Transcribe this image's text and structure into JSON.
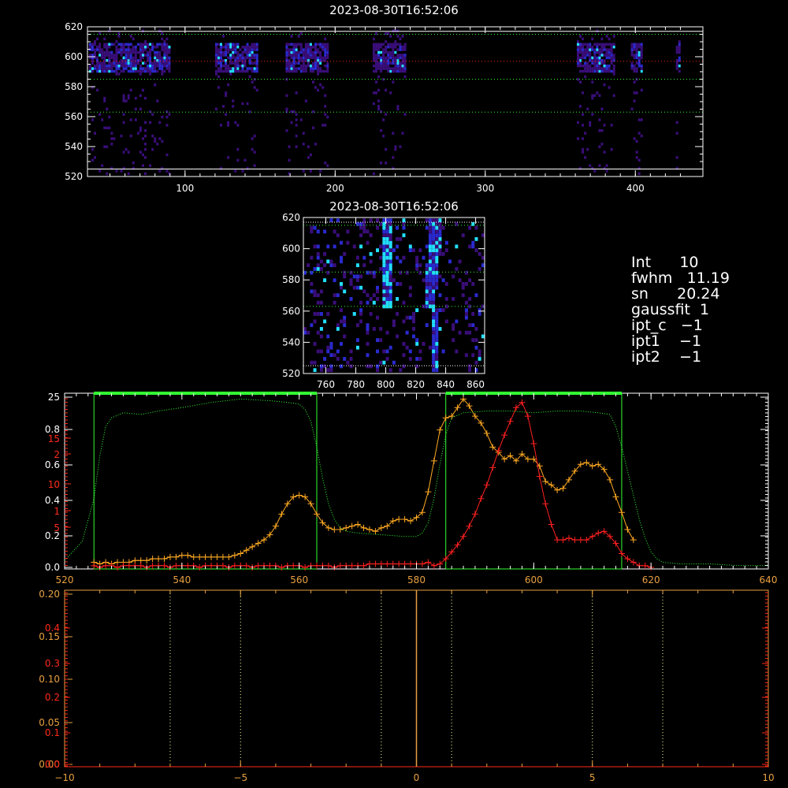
{
  "colors": {
    "background": "#000000",
    "axis": "#ffffff",
    "secondary_axis": "#ff2a1a",
    "orange": "#ffaa22",
    "red": "#ff2020",
    "green": "#33ff33",
    "bottom_axis": "#e8a040",
    "pixel_dark": "#3a0e7a",
    "pixel_mid": "#2a2acf",
    "pixel_bright": "#22e0ff"
  },
  "stats": {
    "int": "Int      10",
    "fwhm": "fwhm   11.19",
    "sn": "sn      20.24",
    "gaussfit": "gaussfit  1",
    "ipt_c": "ipt_c   −1",
    "ipt1": "ipt1    −1",
    "ipt2": "ipt2    −1"
  },
  "chart_data": [
    {
      "type": "heatmap",
      "title": "2023-08-30T16:52:06",
      "xlim": [
        35,
        445
      ],
      "ylim": [
        520,
        620
      ],
      "x_ticks": [
        "100",
        "200",
        "300",
        "400"
      ],
      "y_ticks": [
        "520",
        "540",
        "560",
        "580",
        "600",
        "620"
      ],
      "hlines_white": [
        525,
        617
      ],
      "hlines_green": [
        563,
        585,
        615
      ],
      "hline_red": 597,
      "bright_columns": [
        [
          36,
          90
        ],
        [
          120,
          148
        ],
        [
          167,
          195
        ],
        [
          225,
          246
        ],
        [
          361,
          386
        ],
        [
          397,
          404
        ],
        [
          427,
          430
        ]
      ],
      "bright_band": [
        588,
        608
      ]
    },
    {
      "type": "heatmap",
      "title": "2023-08-30T16:52:06",
      "xlim": [
        745,
        866
      ],
      "ylim": [
        520,
        620
      ],
      "x_ticks": [
        "760",
        "780",
        "800",
        "820",
        "840",
        "860"
      ],
      "y_ticks": [
        "520",
        "540",
        "560",
        "580",
        "600",
        "620"
      ],
      "hlines_green": [
        563,
        585,
        615
      ],
      "hlines_white": [
        525,
        617
      ]
    },
    {
      "type": "line",
      "xlim": [
        520,
        640
      ],
      "ylim": [
        0,
        1
      ],
      "x_ticks": [
        "520",
        "540",
        "560",
        "580",
        "600",
        "620",
        "640"
      ],
      "y_ticks_left": [
        "0.0",
        "0.2",
        "0.4",
        "0.6",
        "0.8",
        "25"
      ],
      "y_ticks_secondary": [
        "5",
        "1",
        "10",
        "2",
        "15"
      ],
      "green_boxes": [
        [
          525,
          563
        ],
        [
          585,
          615
        ]
      ],
      "series": [
        {
          "color": "orange",
          "x": [
            525,
            526,
            527,
            528,
            529,
            530,
            531,
            532,
            533,
            534,
            535,
            536,
            537,
            538,
            539,
            540,
            541,
            542,
            543,
            544,
            545,
            546,
            547,
            548,
            549,
            550,
            551,
            552,
            553,
            554,
            555,
            556,
            557,
            558,
            559,
            560,
            561,
            562,
            563,
            564,
            565,
            566,
            567,
            568,
            569,
            570,
            571,
            572,
            573,
            574,
            575,
            576,
            577,
            578,
            579,
            580,
            581,
            582,
            583,
            584,
            585,
            586,
            587,
            588,
            589,
            590,
            591,
            592,
            593,
            594,
            595,
            596,
            597,
            598,
            599,
            600,
            601,
            602,
            603,
            604,
            605,
            606,
            607,
            608,
            609,
            610,
            611,
            612,
            613,
            614,
            615,
            616,
            617
          ],
          "y": [
            0.03,
            0.02,
            0.03,
            0.02,
            0.03,
            0.03,
            0.03,
            0.04,
            0.04,
            0.04,
            0.05,
            0.05,
            0.05,
            0.06,
            0.06,
            0.07,
            0.07,
            0.06,
            0.06,
            0.06,
            0.06,
            0.06,
            0.06,
            0.06,
            0.07,
            0.08,
            0.1,
            0.12,
            0.14,
            0.16,
            0.19,
            0.24,
            0.31,
            0.37,
            0.41,
            0.42,
            0.41,
            0.37,
            0.31,
            0.26,
            0.23,
            0.22,
            0.22,
            0.23,
            0.24,
            0.25,
            0.23,
            0.22,
            0.21,
            0.23,
            0.24,
            0.27,
            0.28,
            0.28,
            0.27,
            0.29,
            0.32,
            0.44,
            0.62,
            0.8,
            0.87,
            0.88,
            0.93,
            0.98,
            0.94,
            0.88,
            0.84,
            0.78,
            0.7,
            0.67,
            0.63,
            0.65,
            0.62,
            0.66,
            0.63,
            0.63,
            0.59,
            0.5,
            0.48,
            0.45,
            0.46,
            0.51,
            0.56,
            0.6,
            0.61,
            0.59,
            0.6,
            0.57,
            0.51,
            0.41,
            0.32,
            0.22,
            0.16
          ]
        },
        {
          "color": "red",
          "x": [
            525,
            526,
            527,
            528,
            529,
            530,
            531,
            532,
            533,
            534,
            535,
            536,
            537,
            538,
            539,
            540,
            541,
            542,
            543,
            544,
            545,
            546,
            547,
            548,
            549,
            550,
            551,
            552,
            553,
            554,
            555,
            556,
            557,
            558,
            559,
            560,
            561,
            562,
            563,
            564,
            565,
            566,
            567,
            568,
            569,
            570,
            571,
            572,
            573,
            574,
            575,
            576,
            577,
            578,
            579,
            580,
            581,
            582,
            583,
            584,
            585,
            586,
            587,
            588,
            589,
            590,
            591,
            592,
            593,
            594,
            595,
            596,
            597,
            598,
            599,
            600,
            601,
            602,
            603,
            604,
            605,
            606,
            607,
            608,
            609,
            610,
            611,
            612,
            613,
            614,
            615,
            616,
            617,
            618,
            619,
            620
          ],
          "y": [
            0.01,
            0.0,
            0.01,
            0.01,
            0.0,
            0.01,
            0.01,
            0.01,
            0.01,
            0.0,
            0.01,
            0.01,
            0.01,
            0.0,
            0.01,
            0.01,
            0.01,
            0.01,
            0.0,
            0.01,
            0.01,
            0.01,
            0.01,
            0.0,
            0.01,
            0.01,
            0.01,
            0.0,
            0.01,
            0.01,
            0.01,
            0.01,
            0.0,
            0.01,
            0.01,
            0.01,
            0.0,
            0.01,
            0.01,
            0.01,
            0.01,
            0.0,
            0.01,
            0.01,
            0.01,
            0.01,
            0.01,
            0.02,
            0.02,
            0.02,
            0.02,
            0.02,
            0.02,
            0.02,
            0.02,
            0.02,
            0.02,
            0.03,
            0.01,
            0.02,
            0.05,
            0.09,
            0.13,
            0.18,
            0.24,
            0.31,
            0.4,
            0.48,
            0.58,
            0.68,
            0.77,
            0.85,
            0.93,
            0.96,
            0.88,
            0.72,
            0.53,
            0.37,
            0.25,
            0.16,
            0.16,
            0.17,
            0.16,
            0.16,
            0.16,
            0.18,
            0.2,
            0.21,
            0.18,
            0.14,
            0.08,
            0.05,
            0.03,
            0.01,
            0.01,
            0.0
          ]
        },
        {
          "color": "green",
          "style": "dotted",
          "x": [
            520,
            523,
            525,
            526,
            527,
            528,
            530,
            533,
            536,
            540,
            545,
            550,
            555,
            558,
            560,
            561,
            562,
            563,
            564,
            565,
            566,
            567,
            568,
            570,
            574,
            578,
            580,
            581,
            582,
            583,
            584,
            585,
            586,
            588,
            592,
            596,
            600,
            604,
            608,
            611,
            613,
            614,
            615,
            616,
            617,
            618,
            619,
            620,
            621,
            622,
            625,
            630,
            635,
            640
          ],
          "y": [
            0.04,
            0.15,
            0.4,
            0.65,
            0.82,
            0.87,
            0.9,
            0.89,
            0.91,
            0.93,
            0.96,
            0.98,
            0.97,
            0.96,
            0.95,
            0.92,
            0.85,
            0.7,
            0.52,
            0.37,
            0.28,
            0.23,
            0.21,
            0.2,
            0.19,
            0.18,
            0.18,
            0.2,
            0.26,
            0.4,
            0.6,
            0.77,
            0.87,
            0.9,
            0.91,
            0.91,
            0.9,
            0.91,
            0.91,
            0.9,
            0.89,
            0.82,
            0.7,
            0.56,
            0.42,
            0.28,
            0.17,
            0.09,
            0.05,
            0.03,
            0.02,
            0.02,
            0.01,
            0.01
          ]
        }
      ]
    },
    {
      "type": "line",
      "xlim": [
        -10,
        10
      ],
      "x_ticks": [
        "−10",
        "−5",
        "0",
        "5",
        "10"
      ],
      "y_ticks_left": [
        "0.00",
        "0.05",
        "0.10",
        "0.15",
        "0.20"
      ],
      "y_ticks_secondary": [
        "0.0",
        "0.1",
        "0.2",
        "0.3",
        "0.4"
      ],
      "vlines_dotted": [
        -7,
        -5,
        -1,
        1,
        5,
        7
      ],
      "vline_center": 0
    }
  ]
}
